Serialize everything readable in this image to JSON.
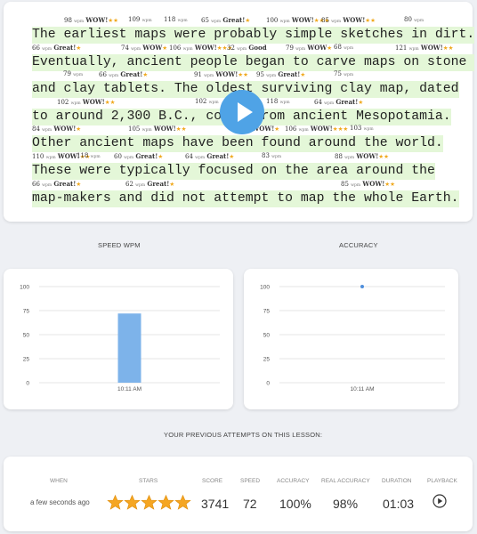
{
  "lesson": {
    "lines": [
      {
        "text": "The earliest maps were probably simple sketches in dirt.",
        "marks": [
          {
            "num": "98",
            "label": "WOW!",
            "stars": "★★",
            "x": 36
          },
          {
            "num": "109",
            "label": "",
            "stars": "",
            "x": 108
          },
          {
            "num": "118",
            "label": "",
            "stars": "",
            "x": 148
          },
          {
            "num": "65",
            "label": "Great!",
            "stars": "★",
            "x": 190
          },
          {
            "num": "100",
            "label": "WOW!",
            "stars": "★★★",
            "x": 263
          },
          {
            "num": "85",
            "label": "WOW!",
            "stars": "★★",
            "x": 325
          },
          {
            "num": "80",
            "label": "",
            "stars": "",
            "x": 418
          }
        ]
      },
      {
        "text": "Eventually, ancient people began to carve maps on stone ",
        "marks": [
          {
            "num": "66",
            "label": "Great!",
            "stars": "★",
            "x": 0
          },
          {
            "num": "74",
            "label": "WOW",
            "stars": "★",
            "x": 100
          },
          {
            "num": "106",
            "label": "WOW!",
            "stars": "★★★",
            "x": 154
          },
          {
            "num": "32",
            "label": "Good",
            "stars": "",
            "x": 219
          },
          {
            "num": "79",
            "label": "WOW",
            "stars": "★",
            "x": 285
          },
          {
            "num": "68",
            "label": "",
            "stars": "",
            "x": 339
          },
          {
            "num": "121",
            "label": "WOW!",
            "stars": "★★",
            "x": 408
          }
        ]
      },
      {
        "text": "and clay tablets. The oldest surviving clay map, dated",
        "marks": [
          {
            "num": "79",
            "label": "",
            "stars": "",
            "x": 35
          },
          {
            "num": "66",
            "label": "Great!",
            "stars": "★",
            "x": 75
          },
          {
            "num": "91",
            "label": "WOW!",
            "stars": "★★",
            "x": 182
          },
          {
            "num": "95",
            "label": "Great!",
            "stars": "★",
            "x": 252
          },
          {
            "num": "75",
            "label": "",
            "stars": "",
            "x": 339
          }
        ]
      },
      {
        "text": "to around 2,300 B.C., comes from ancient Mesopotamia.",
        "marks": [
          {
            "num": "102",
            "label": "WOW!",
            "stars": "★★",
            "x": 28
          },
          {
            "num": "102",
            "label": "",
            "stars": "",
            "x": 183
          },
          {
            "num": "118",
            "label": "",
            "stars": "",
            "x": 263
          },
          {
            "num": "64",
            "label": "Great!",
            "stars": "★",
            "x": 317
          }
        ]
      },
      {
        "text": "Other ancient maps have been found around the world.",
        "marks": [
          {
            "num": "84",
            "label": "WOW!",
            "stars": "★",
            "x": 0
          },
          {
            "num": "105",
            "label": "WOW!",
            "stars": "★★",
            "x": 108
          },
          {
            "num": "88",
            "label": "WOW!",
            "stars": "★",
            "x": 223
          },
          {
            "num": "106",
            "label": "WOW!",
            "stars": "★★★",
            "x": 284
          },
          {
            "num": "103",
            "label": "",
            "stars": "",
            "x": 357
          }
        ]
      },
      {
        "text": "These were typically focused on the area around the",
        "marks": [
          {
            "num": "110",
            "label": "WOW!",
            "stars": "★★",
            "x": 0
          },
          {
            "num": "118",
            "label": "",
            "stars": "",
            "x": 50
          },
          {
            "num": "60",
            "label": "Great!",
            "stars": "★",
            "x": 92
          },
          {
            "num": "64",
            "label": "Great!",
            "stars": "★",
            "x": 172
          },
          {
            "num": "83",
            "label": "",
            "stars": "",
            "x": 258
          },
          {
            "num": "88",
            "label": "WOW!",
            "stars": "★★",
            "x": 340
          }
        ]
      },
      {
        "text": "map-makers and did not attempt to map the whole Earth.",
        "marks": [
          {
            "num": "66",
            "label": "Great!",
            "stars": "★",
            "x": 0
          },
          {
            "num": "62",
            "label": "Great!",
            "stars": "★",
            "x": 105
          },
          {
            "num": "85",
            "label": "WOW!",
            "stars": "★★",
            "x": 347
          }
        ]
      }
    ],
    "wpm_unit": "wpm"
  },
  "speed_chart": {
    "title": "SPEED WPM",
    "chart_data": {
      "type": "bar",
      "categories": [
        "10:11 AM"
      ],
      "values": [
        72
      ],
      "ylim": [
        0,
        100
      ],
      "yticks": [
        "100",
        "75",
        "50",
        "25",
        "0"
      ],
      "color": "#7db3ea"
    }
  },
  "accuracy_chart": {
    "title": "ACCURACY",
    "chart_data": {
      "type": "scatter",
      "categories": [
        "10:11 AM"
      ],
      "values": [
        100
      ],
      "ylim": [
        0,
        100
      ],
      "yticks": [
        "100",
        "75",
        "50",
        "25",
        "0"
      ],
      "color": "#4f8fdc"
    }
  },
  "attempts": {
    "title": "YOUR PREVIOUS ATTEMPTS ON THIS LESSON:",
    "headers": [
      "WHEN",
      "STARS",
      "SCORE",
      "SPEED",
      "ACCURACY",
      "REAL ACCURACY",
      "DURATION",
      "PLAYBACK"
    ],
    "row": {
      "when": "a few seconds ago",
      "stars": 5,
      "score": "3741",
      "speed": "72",
      "accuracy": "100%",
      "real_accuracy": "98%",
      "duration": "01:03"
    }
  },
  "colors": {
    "text_highlight": "#e4f7d8",
    "star": "#f5a623",
    "play_button": "#4fa3e6"
  }
}
